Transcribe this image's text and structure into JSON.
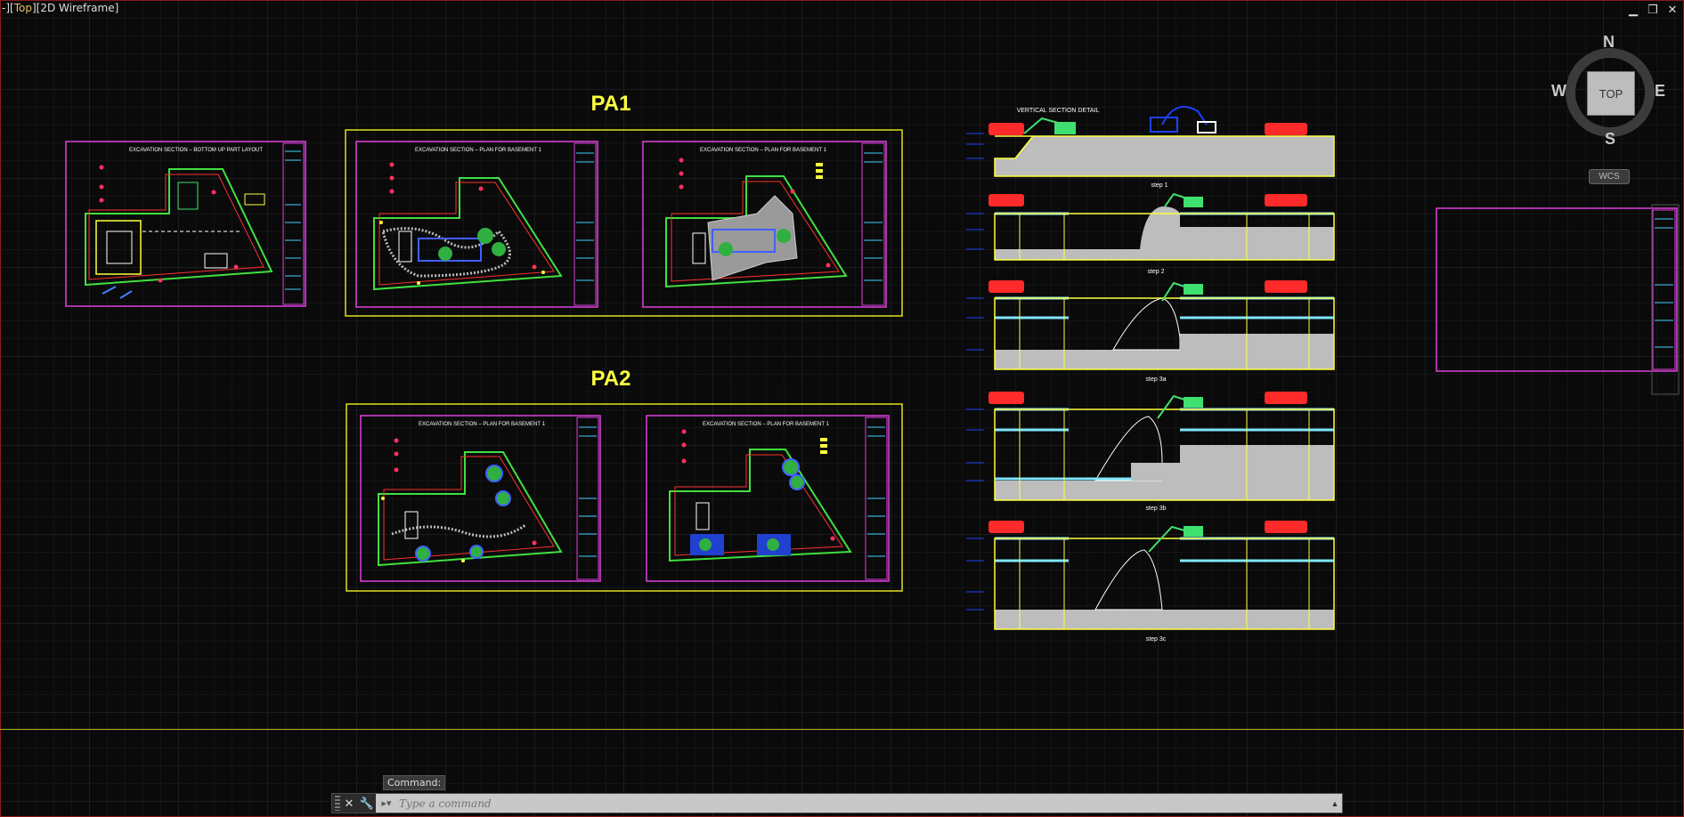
{
  "viewport": {
    "controls": "-][",
    "view": "Top",
    "style": "][2D Wireframe]"
  },
  "window_controls": {
    "minimize": "▁",
    "restore": "❐",
    "close": "✕"
  },
  "drawing": {
    "label_pa1": "PA1",
    "label_pa2": "PA2",
    "sheet_left_title": "EXCAVATION SECTION – BOTTOM UP PART LAYOUT",
    "pa1_sheet1_title": "EXCAVATION SECTION – PLAN FOR BASEMENT 1",
    "pa1_sheet2_title": "EXCAVATION SECTION – PLAN FOR BASEMENT 1",
    "pa2_sheet1_title": "EXCAVATION SECTION – PLAN FOR BASEMENT 1",
    "pa2_sheet2_title": "EXCAVATION SECTION – PLAN FOR BASEMENT 1",
    "section_title": "VERTICAL SECTION DETAIL",
    "steps": [
      "step 1",
      "step 2",
      "step 3a",
      "step 3b",
      "step 3c"
    ]
  },
  "viewcube": {
    "north": "N",
    "south": "S",
    "east": "E",
    "west": "W",
    "face": "TOP",
    "wcs": "WCS"
  },
  "command": {
    "history_label": "Command:",
    "placeholder": "Type a command"
  },
  "colors": {
    "sheet_border": "#e040e0",
    "group_frame": "#e0e020",
    "title_yellow": "#ffff40",
    "truck_red": "#ff2a2a",
    "excavator_green": "#40e070",
    "slab_cyan": "#7fe6ff",
    "soil_gray": "#bdbdbd"
  }
}
